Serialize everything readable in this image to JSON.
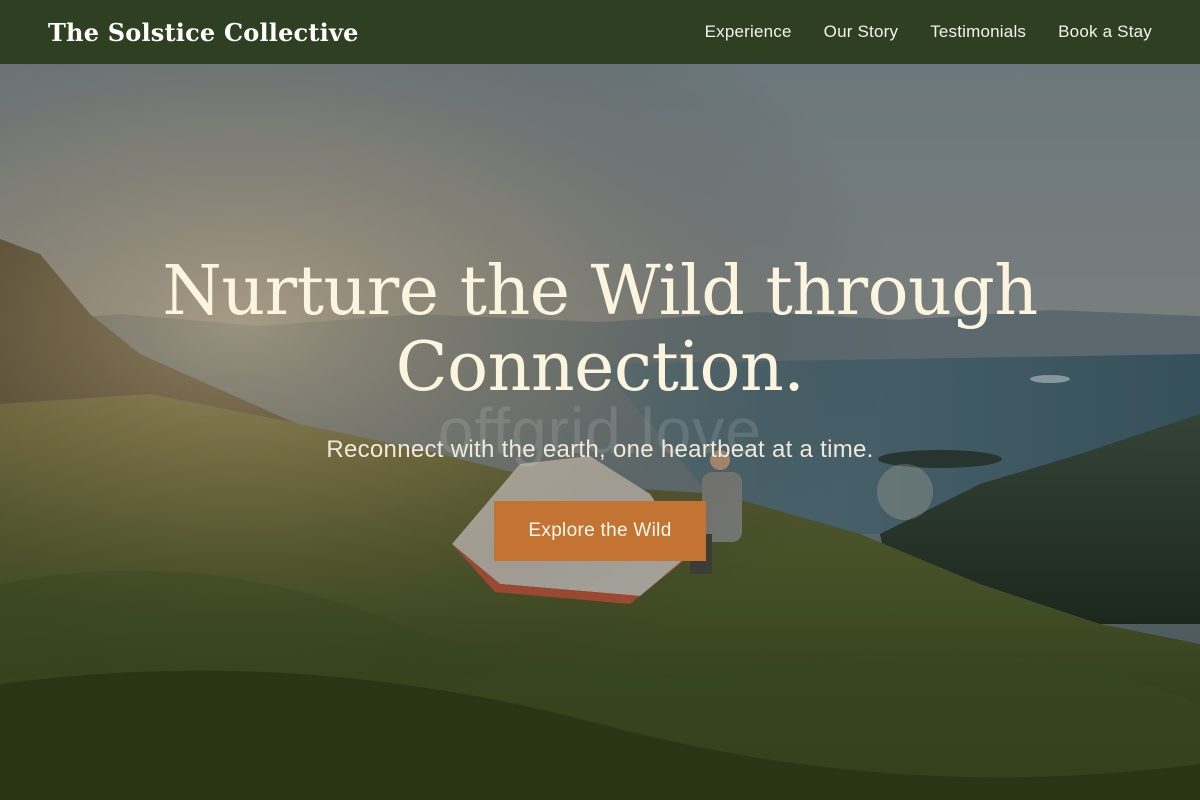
{
  "header": {
    "brand": "The Solstice Collective",
    "nav": [
      {
        "label": "Experience"
      },
      {
        "label": "Our Story"
      },
      {
        "label": "Testimonials"
      },
      {
        "label": "Book a Stay"
      }
    ]
  },
  "hero": {
    "title": "Nurture the Wild through Connection.",
    "subtitle": "Reconnect with the earth, one heartbeat at a time.",
    "watermark": "offgrid.love",
    "cta_label": "Explore the Wild"
  },
  "colors": {
    "header_bg": "#2f3f22",
    "cta_bg": "#c37332",
    "title_text": "#fbf5df"
  }
}
